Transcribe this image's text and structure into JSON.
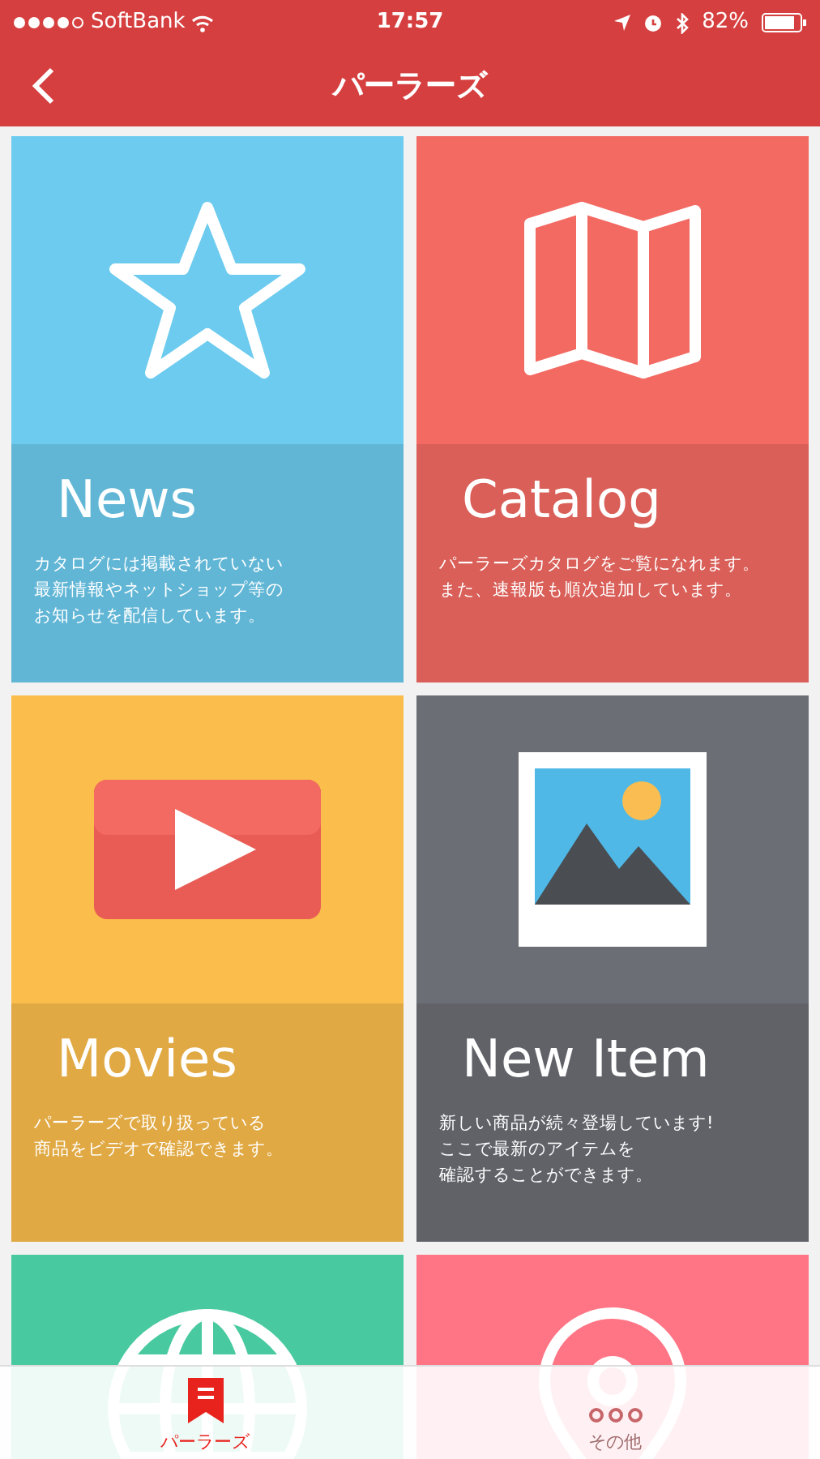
{
  "status_bar": {
    "carrier": "SoftBank",
    "time": "17:57",
    "battery": "82%"
  },
  "nav": {
    "title": "パーラーズ"
  },
  "tiles": [
    {
      "kind": "star",
      "title": "News",
      "lines": [
        "カタログには掲載されていない",
        "最新情報やネットショップ等の",
        "お知らせを配信しています。"
      ],
      "color": "#6ccbef"
    },
    {
      "kind": "map",
      "title": "Catalog",
      "lines": [
        "パーラーズカタログをご覧になれます。",
        "また、速報版も順次追加しています。"
      ],
      "color": "#f26a62"
    },
    {
      "kind": "video",
      "title": "Movies",
      "lines": [
        "パーラーズで取り扱っている",
        "商品をビデオで確認できます。"
      ],
      "color": "#fbbd4b"
    },
    {
      "kind": "photo",
      "title": "New Item",
      "lines": [
        "新しい商品が続々登場しています!",
        "ここで最新のアイテムを",
        "確認することができます。"
      ],
      "color": "#6b6e74"
    },
    {
      "kind": "globe",
      "color": "#48c9a0"
    },
    {
      "kind": "pin",
      "color": "#ff7585"
    }
  ],
  "tab_bar": [
    {
      "label": "パーラーズ",
      "kind": "bookmark",
      "selected": true
    },
    {
      "label": "その他",
      "kind": "more",
      "selected": false
    }
  ]
}
